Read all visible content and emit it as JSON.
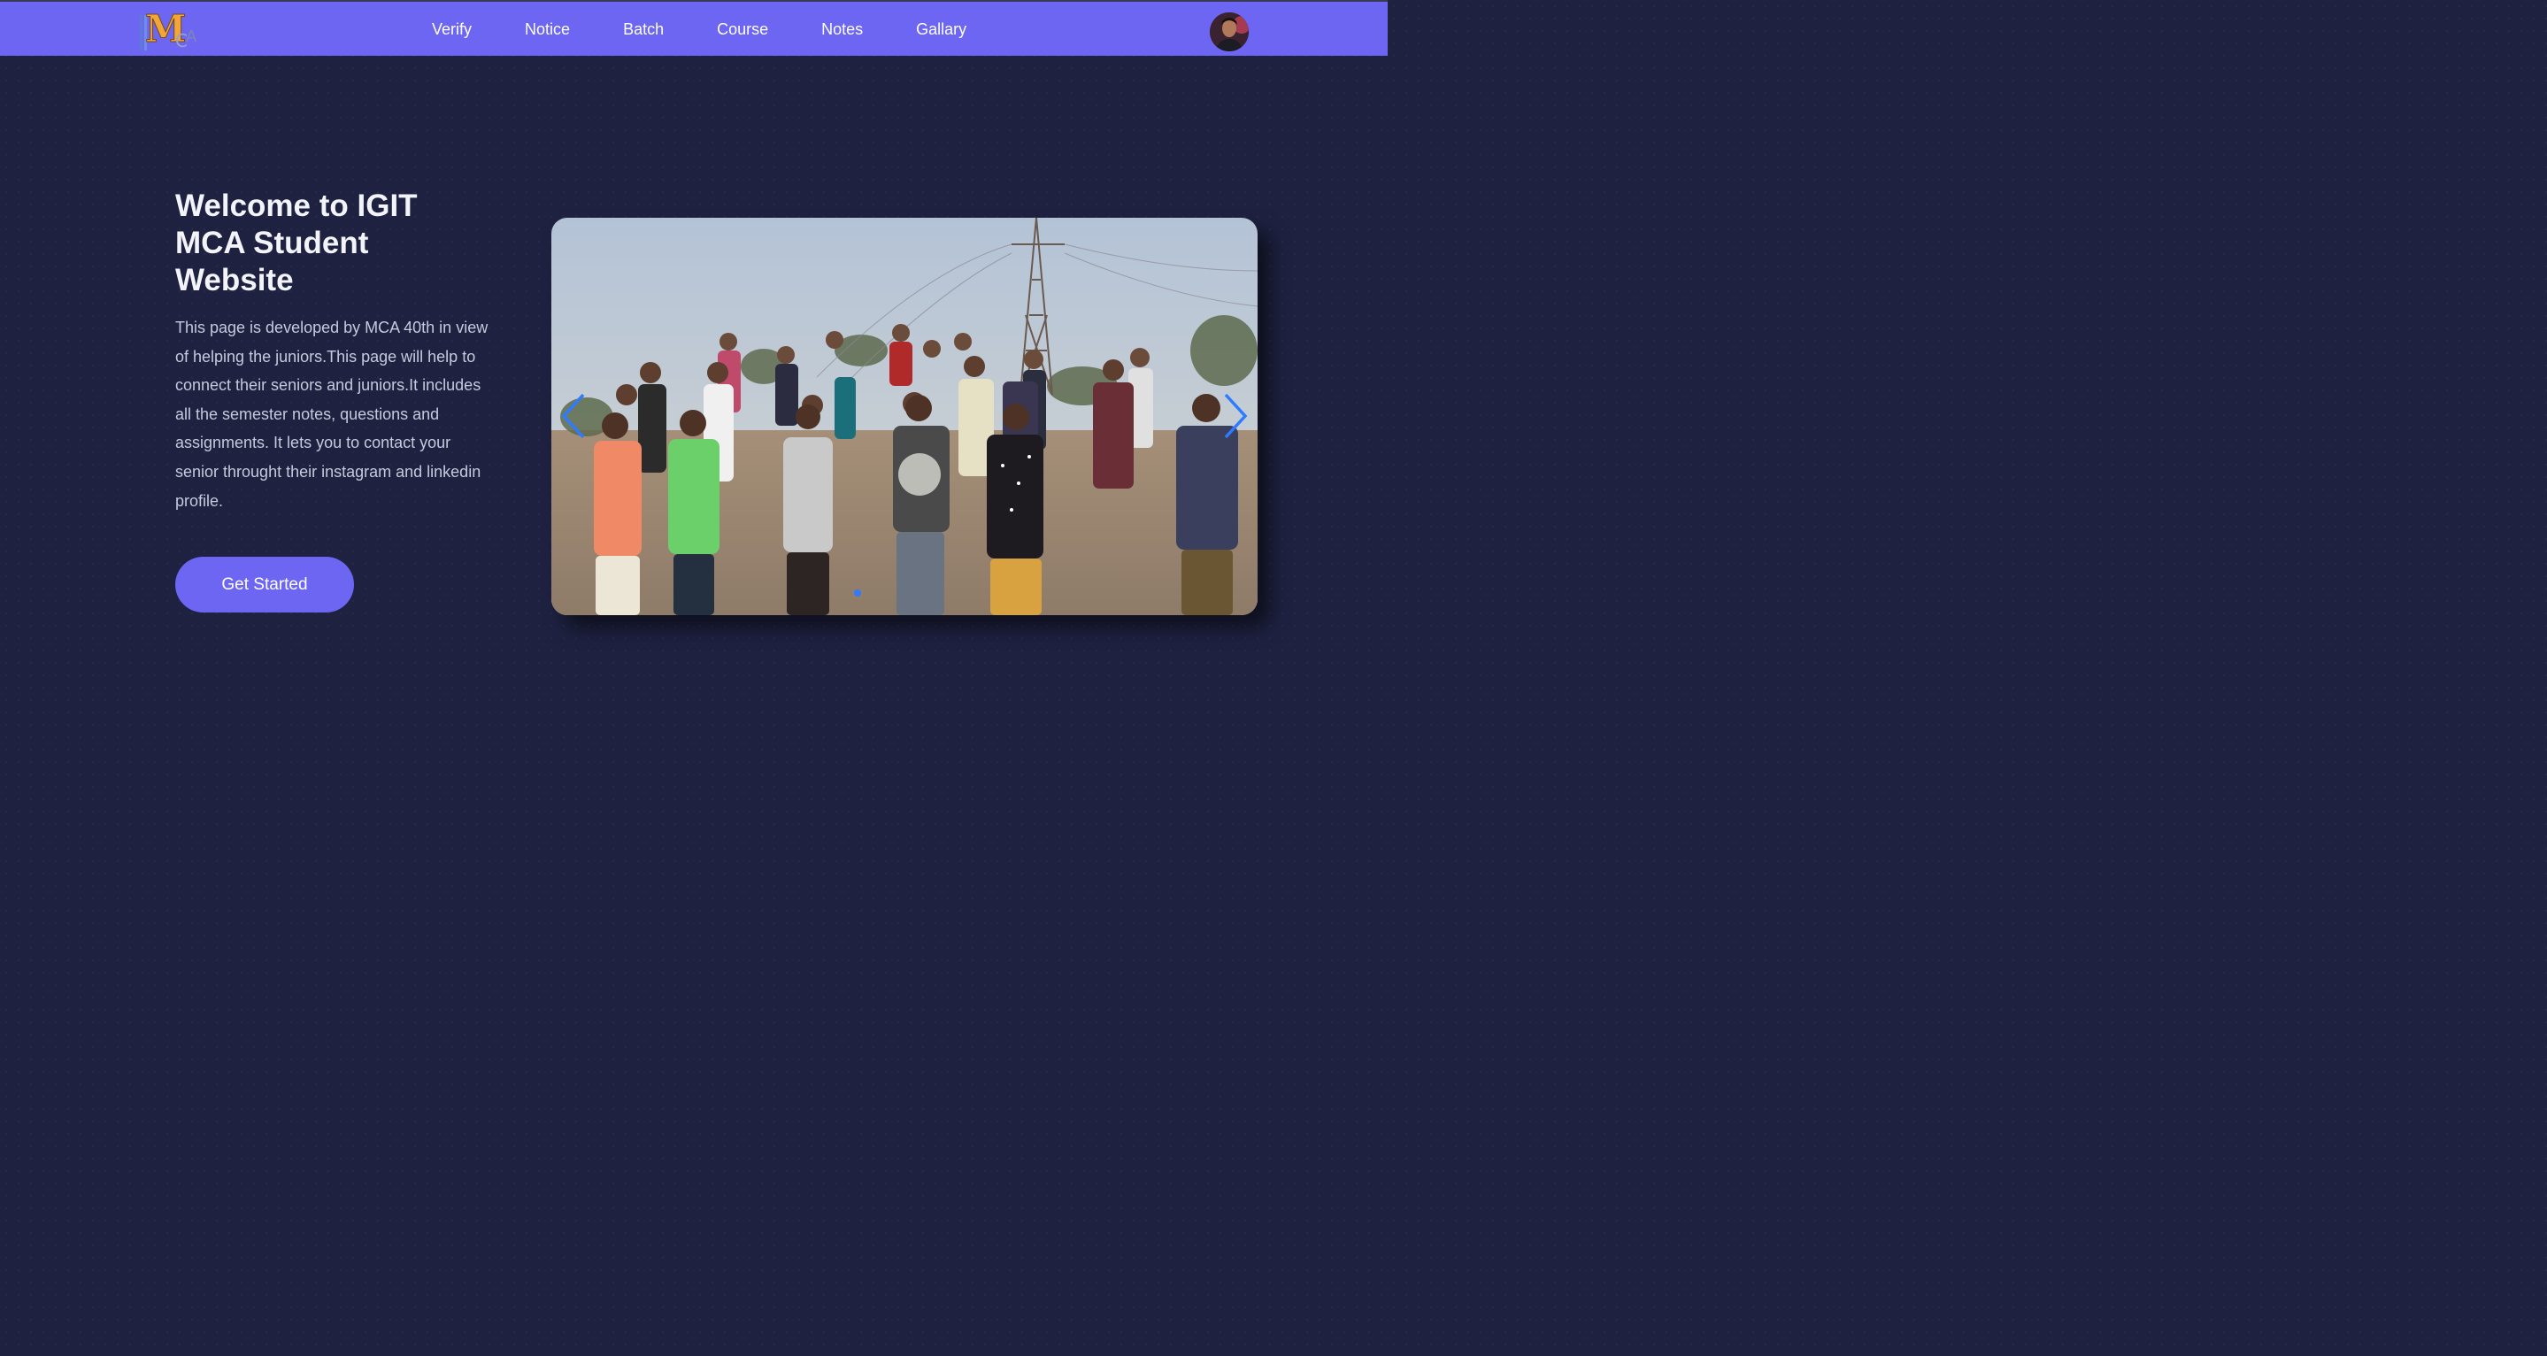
{
  "nav": {
    "links": [
      {
        "label": "Verify"
      },
      {
        "label": "Notice"
      },
      {
        "label": "Batch"
      },
      {
        "label": "Course"
      },
      {
        "label": "Notes"
      },
      {
        "label": "Gallary"
      }
    ],
    "logo_icon": "mca-logo",
    "avatar_icon": "user-avatar"
  },
  "hero": {
    "title": "Welcome to IGIT MCA Student Website",
    "description": "This page is developed by MCA 40th in view of helping the juniors.This page will help to connect their seniors and juniors.It includes all the semester notes, questions and assignments. It lets you to contact your senior throught their instagram and linkedin profile.",
    "cta_label": "Get Started"
  },
  "carousel": {
    "prev_icon": "chevron-left-icon",
    "next_icon": "chevron-right-icon",
    "slide_count": 1,
    "active_index": 0
  },
  "colors": {
    "nav_bg": "#6c66f2",
    "page_bg": "#1e2140",
    "accent": "#6c66f2",
    "arrow": "#2f7bff"
  }
}
